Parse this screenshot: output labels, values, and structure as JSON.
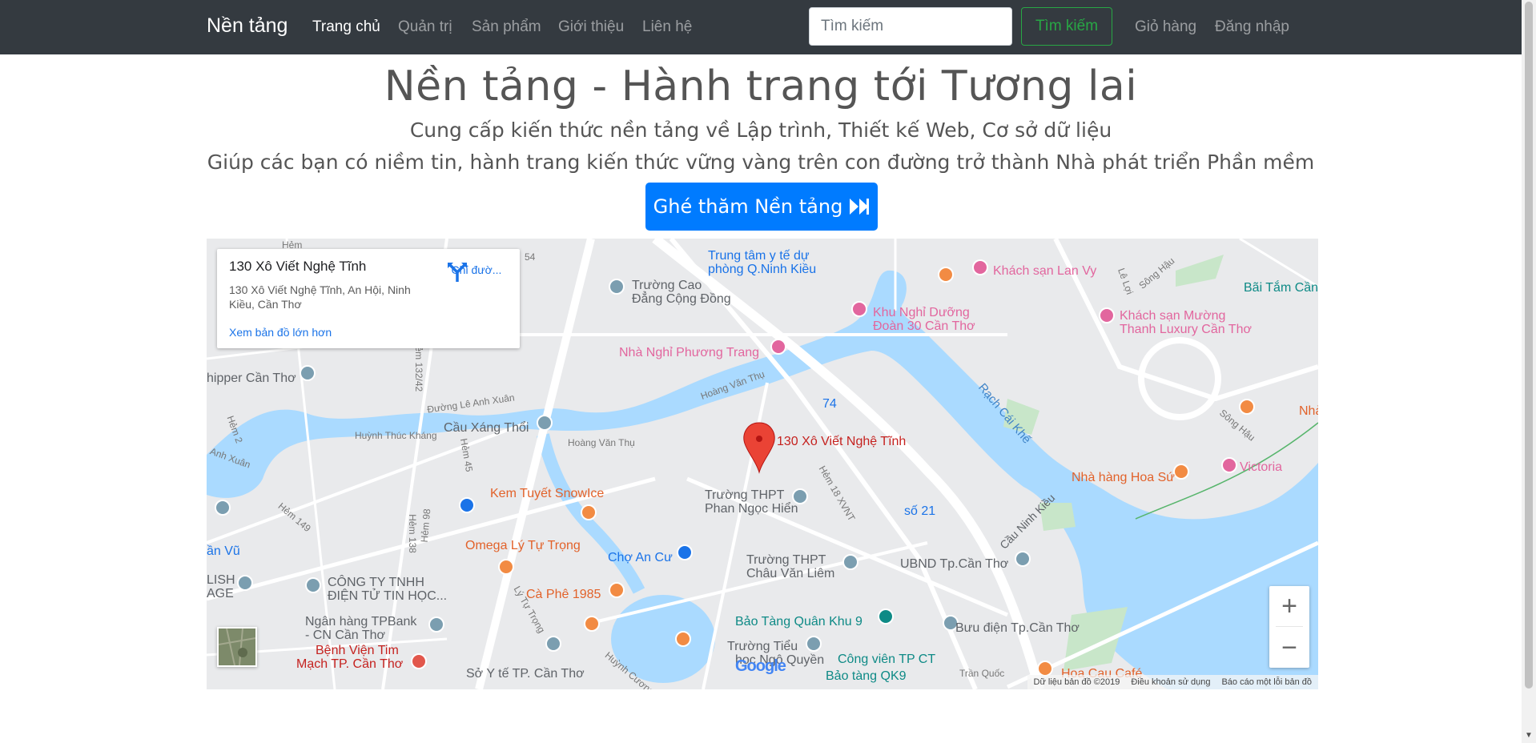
{
  "navbar": {
    "brand": "Nền tảng",
    "links": [
      "Trang chủ",
      "Quản trị",
      "Sản phẩm",
      "Giới thiệu",
      "Liên hệ"
    ],
    "search_placeholder": "Tìm kiếm",
    "search_button": "Tìm kiếm",
    "right_links": [
      "Giỏ hàng",
      "Đăng nhập"
    ]
  },
  "hero": {
    "title": "Nền tảng - Hành trang tới Tương lai",
    "subtitle_1": "Cung cấp kiến thức nền tảng về Lập trình, Thiết kế Web, Cơ sở dữ liệu",
    "subtitle_2": "Giúp các bạn có niềm tin, hành trang kiến thức vững vàng trên con đường trở thành Nhà phát triển Phần mềm",
    "button_label": "Ghé thăm Nền tảng",
    "button_icon": "fast-forward-icon",
    "button_color": "#007bff"
  },
  "map": {
    "info_card": {
      "title": "130 Xô Viết Nghệ Tĩnh",
      "address": "130 Xô Viết Nghệ Tĩnh, An Hội, Ninh Kiều, Cần Thơ",
      "directions_label": "Chỉ đườ...",
      "larger_map_link": "Xem bản đồ lớn hơn"
    },
    "marker_label": "130 Xô Viết Nghệ Tĩnh",
    "places": {
      "trung_tam_y_te": "Trung tâm y tế dự",
      "trung_tam_y_te_2": "phòng Q.Ninh Kiều",
      "truong_cao_dang": "Trường Cao",
      "truong_cao_dang_2": "Đẳng Cộng Đồng",
      "khach_san_lan_vy": "Khách sạn Lan Vy",
      "khu_nghi_duong": "Khu Nghỉ Dưỡng",
      "khu_nghi_duong_2": "Đoàn 30 Cần Thơ",
      "khach_san_muong": "Khách sạn Mường",
      "khach_san_muong_2": "Thanh Luxury Cần Thơ",
      "bai_tam": "Bãi Tắm Cần",
      "nha_nghi": "Nhà Nghỉ Phương Trang",
      "shipper": "hipper Cần Thơ",
      "cau_xang_thoi": "Cầu Xáng Thổi",
      "so_74": "74",
      "rach_cai_khe": "Rạch Cái Khế",
      "nha": "Nhà",
      "kem": "Kem Tuyết SnowIce",
      "thpt_phan": "Trường THPT",
      "thpt_phan_2": "Phan Ngọc Hiển",
      "nha_hang_hoa_su": "Nhà hàng Hoa Sứ",
      "victoria": "Victoria",
      "so_21": "số 21",
      "cau_ninh_kieu": "Cầu Ninh Kiều",
      "an_vu": "ần Vũ",
      "omega": "Omega Lý Tự Trọng",
      "cho_an_cu": "Chợ An Cư",
      "thpt_chau": "Trường THPT",
      "thpt_chau_2": "Châu Văn Liêm",
      "ubnd": "UBND Tp.Cần Thơ",
      "lish": "LISH",
      "age": "AGE",
      "cong_ty": "CÔNG TY TNHH",
      "cong_ty_2": "ĐIỆN TỬ TIN HỌC...",
      "ca_phe": "Cà Phê 1985",
      "ngan_hang": "Ngân hàng TPBank",
      "ngan_hang_2": "- CN Cần Thơ",
      "bao_tang_qk9": "Bảo Tàng Quân Khu 9",
      "buu_dien": "Bưu điện Tp.Cần Thơ",
      "benh_vien": "Bệnh Viện Tim",
      "benh_vien_2": "Mạch TP. Cần Thơ",
      "so_y_te": "Sở Y tế TP. Cần Thơ",
      "truong_tieu_hoc": "Trường Tiểu",
      "truong_tieu_hoc_2": "học Ngô Quyền",
      "cong_vien": "Công viên TP CT",
      "bao_tang_qk9_2": "Bảo tàng QK9",
      "hoa_cau_cafe": "Hoa Cau Café"
    },
    "streets": {
      "le_anh_xuan": "Đường Lê Anh Xuân",
      "hoang_van_thu_1": "Hoàng Văn Thụ",
      "hoang_van_thu_2": "Hoàng Văn Thụ",
      "huynh_thuc_khang": "Huỳnh Thúc Kháng",
      "hem_2": "Hẻm 2",
      "anh_xuan": "Anh Xuân",
      "hem_132": "Hẻm 132/42",
      "hem_45": "Hẻm 45",
      "hem_149": "Hẻm 149",
      "hem_138": "Hẻm 138",
      "hem_98": "Hẻm 98",
      "hem_18": "Hẻm 18 XVNT",
      "ly_tu_trong": "Lý Tự Trọng",
      "huynh_cuong": "Huỳnh Cương",
      "tran_quoc": "Trần Quốc",
      "le_loi": "Lê Lợi",
      "song_hau_1": "Sông Hậu",
      "song_hau_2": "Sông Hậu",
      "hem": "Hẻm",
      "hem_54": "54"
    },
    "google_logo": "Google",
    "attribution": [
      "Dữ liệu bản đồ ©2019",
      "Điều khoản sử dụng",
      "Báo cáo một lỗi bản đồ"
    ],
    "zoom_in": "+",
    "zoom_out": "−",
    "colors": {
      "water": "#aadaff",
      "road": "#ffffff",
      "land": "#e9eaec",
      "park": "#c8e6c9",
      "marker": "#ea4335"
    }
  }
}
